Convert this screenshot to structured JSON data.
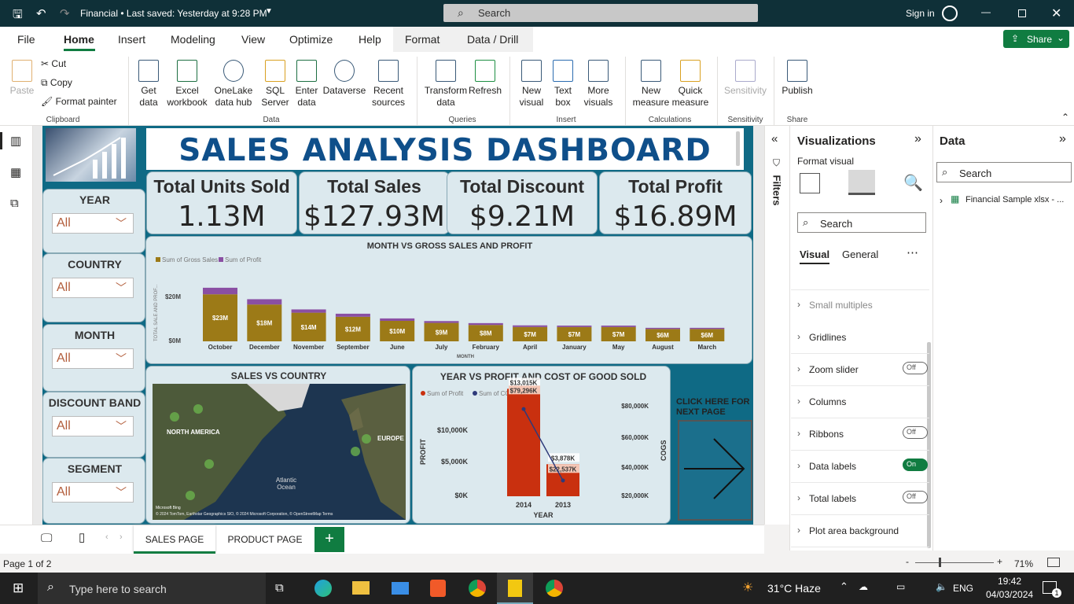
{
  "titlebar": {
    "doc": "Financial • Last saved: Yesterday at 9:28 PM",
    "search": "Search",
    "signin": "Sign in"
  },
  "menu": [
    "File",
    "Home",
    "Insert",
    "Modeling",
    "View",
    "Optimize",
    "Help",
    "Format",
    "Data / Drill"
  ],
  "share": "Share",
  "ribbon": {
    "paste": "Paste",
    "cut": "Cut",
    "copy": "Copy",
    "format_painter": "Format painter",
    "clipboard": "Clipboard",
    "get_data": "Get data",
    "excel": "Excel workbook",
    "onelake": "OneLake data hub",
    "sql": "SQL Server",
    "enter": "Enter data",
    "dataverse": "Dataverse",
    "recent": "Recent sources",
    "data": "Data",
    "transform": "Transform data",
    "refresh": "Refresh",
    "queries": "Queries",
    "new_visual": "New visual",
    "text_box": "Text box",
    "more_visuals": "More visuals",
    "insert": "Insert",
    "new_measure": "New measure",
    "quick_measure": "Quick measure",
    "calculations": "Calculations",
    "sensitivity": "Sensitivity",
    "publish": "Publish",
    "share_grp": "Share"
  },
  "report": {
    "title": "SALES ANALYSIS DASHBOARD",
    "slicers": [
      {
        "label": "YEAR",
        "value": "All"
      },
      {
        "label": "COUNTRY",
        "value": "All"
      },
      {
        "label": "MONTH",
        "value": "All"
      },
      {
        "label": "DISCOUNT BAND",
        "value": "All"
      },
      {
        "label": "SEGMENT",
        "value": "All"
      }
    ],
    "kpis": [
      {
        "title": "Total Units Sold",
        "value": "1.13M"
      },
      {
        "title": "Total Sales",
        "value": "$127.93M"
      },
      {
        "title": "Total Discount",
        "value": "$9.21M"
      },
      {
        "title": "Total Profit",
        "value": "$16.89M"
      }
    ],
    "map": {
      "title": "SALES VS COUNTRY",
      "na": "NORTH AMERICA",
      "eu": "EUROPE",
      "ocean": "Atlantic Ocean",
      "credit": "© 2024 TomTom, Earthstar Geographics SIO, © 2024 Microsoft Corporation, © OpenStreetMap Terms",
      "ms": "Microsoft Bing"
    },
    "cta": "CLICK HERE FOR NEXT PAGE"
  },
  "chart_data": [
    {
      "type": "bar",
      "title": "MONTH VS GROSS SALES AND PROFIT",
      "xlabel": "MONTH",
      "ylabel": "TOTAL SALE AND PROF...",
      "legend": [
        "Sum of Gross Sales",
        "Sum of Profit"
      ],
      "colors": {
        "sales": "#9c7a17",
        "profit": "#8a4fa3"
      },
      "yticks": [
        "$20M",
        "$0M"
      ],
      "ylim": [
        0,
        30
      ],
      "categories": [
        "October",
        "December",
        "November",
        "September",
        "June",
        "July",
        "February",
        "April",
        "January",
        "May",
        "August",
        "March"
      ],
      "sales_labels": [
        "$23M",
        "$18M",
        "$14M",
        "$12M",
        "$10M",
        "$9M",
        "$8M",
        "$7M",
        "$7M",
        "$7M",
        "$6M",
        "$6M"
      ],
      "sales": [
        23,
        18,
        14,
        12,
        10,
        9,
        8,
        7,
        7,
        7,
        6,
        6
      ],
      "profit": [
        3.2,
        2.6,
        1.6,
        1.5,
        1.2,
        0.9,
        0.9,
        0.8,
        0.7,
        0.7,
        0.6,
        0.6
      ]
    },
    {
      "type": "bar",
      "title": "YEAR VS PROFIT AND COST OF GOOD SOLD",
      "xlabel": "YEAR",
      "ylabel": "PROFIT",
      "y2label": "COGS",
      "legend": [
        "Sum of Profit",
        "Sum of COGS"
      ],
      "colors": {
        "profit": "#c9300f",
        "cogs": "#2e3a7a"
      },
      "categories": [
        "2014",
        "2013"
      ],
      "profit_labels": [
        "$13,015K",
        "$3,878K"
      ],
      "cogs_labels": [
        "$79,296K",
        "$22,537K"
      ],
      "profit": [
        13015,
        3878
      ],
      "cogs": [
        79296,
        22537
      ],
      "yticks": [
        "$10,000K",
        "$5,000K",
        "$0K"
      ],
      "y2ticks": [
        "$80,000K",
        "$60,000K",
        "$40,000K",
        "$20,000K"
      ]
    }
  ],
  "filters_label": "Filters",
  "viz": {
    "title": "Visualizations",
    "format": "Format visual",
    "search": "Search",
    "tab_visual": "Visual",
    "tab_general": "General",
    "rows": [
      {
        "label": "Small multiples",
        "toggle": ""
      },
      {
        "label": "Gridlines",
        "toggle": ""
      },
      {
        "label": "Zoom slider",
        "toggle": "Off"
      },
      {
        "label": "Columns",
        "toggle": ""
      },
      {
        "label": "Ribbons",
        "toggle": "Off"
      },
      {
        "label": "Data labels",
        "toggle": "On"
      },
      {
        "label": "Total labels",
        "toggle": "Off"
      },
      {
        "label": "Plot area background",
        "toggle": ""
      }
    ]
  },
  "datapane": {
    "title": "Data",
    "search": "Search",
    "table": "Financial Sample xlsx - ..."
  },
  "pages": [
    "SALES PAGE",
    "PRODUCT PAGE"
  ],
  "status": {
    "page": "Page 1 of 2",
    "zoom": "71%"
  },
  "taskbar": {
    "search": "Type here to search",
    "weather": "31°C  Haze",
    "lang": "ENG",
    "time": "19:42",
    "date": "04/03/2024",
    "notif": "1"
  }
}
